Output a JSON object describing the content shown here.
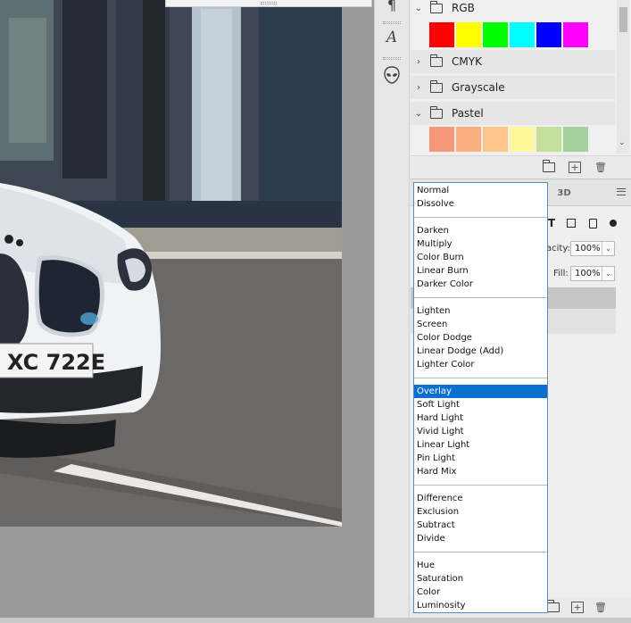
{
  "swatches": {
    "groups": [
      {
        "label": "RGB",
        "expanded": true,
        "colors": [
          "#ff0000",
          "#ffff00",
          "#00ff00",
          "#00ffff",
          "#0000ff",
          "#ff00ff"
        ]
      },
      {
        "label": "CMYK",
        "expanded": false
      },
      {
        "label": "Grayscale",
        "expanded": false
      },
      {
        "label": "Pastel",
        "expanded": true,
        "colors": [
          "#f7977a",
          "#f9ad81",
          "#fdc68a",
          "#fff79a",
          "#c4df9b",
          "#a2d39c"
        ]
      }
    ]
  },
  "tool_strip": {
    "icons": [
      "paragraph-icon",
      "character-style-icon",
      "alien-extension-icon"
    ],
    "paragraph_glyph": "¶",
    "character_glyph": "A"
  },
  "layers": {
    "tab_3d": "3D",
    "opacity_label": "acity:",
    "opacity_value": "100%",
    "fill_label": "Fill:",
    "fill_value": "100%",
    "type_filter_glyph": "T"
  },
  "blend_menu": {
    "groups": [
      [
        "Normal",
        "Dissolve"
      ],
      [
        "Darken",
        "Multiply",
        "Color Burn",
        "Linear Burn",
        "Darker Color"
      ],
      [
        "Lighten",
        "Screen",
        "Color Dodge",
        "Linear Dodge (Add)",
        "Lighter Color"
      ],
      [
        "Overlay",
        "Soft Light",
        "Hard Light",
        "Vivid Light",
        "Linear Light",
        "Pin Light",
        "Hard Mix"
      ],
      [
        "Difference",
        "Exclusion",
        "Subtract",
        "Divide"
      ],
      [
        "Hue",
        "Saturation",
        "Color",
        "Luminosity"
      ]
    ],
    "selected": "Overlay"
  },
  "photo": {
    "plate_text": "XC 722E"
  }
}
